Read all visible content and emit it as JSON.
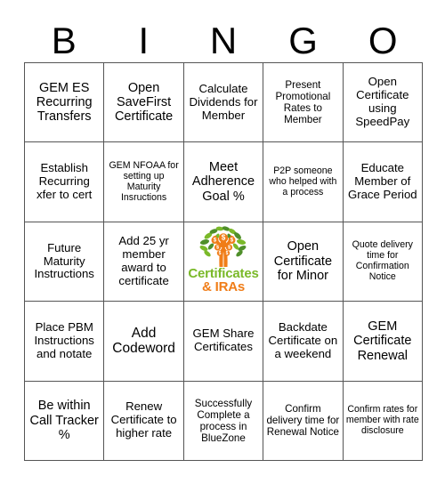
{
  "header": {
    "letters": [
      "B",
      "I",
      "N",
      "G",
      "O"
    ]
  },
  "free_space": {
    "logo_line1": "Certificates",
    "logo_line2": "& IRAs",
    "logo_icon": "money-tree-person-icon",
    "green": "#7ab929",
    "orange": "#f07d18"
  },
  "grid": {
    "rows": 5,
    "columns": 5,
    "cells": [
      {
        "text": "GEM ES Recurring Transfers",
        "size": "fs-lg"
      },
      {
        "text": "Open SaveFirst Certificate",
        "size": "fs-lg"
      },
      {
        "text": "Calculate Dividends for Member",
        "size": "fs-md"
      },
      {
        "text": "Present Promotional Rates to Member",
        "size": "fs-sm"
      },
      {
        "text": "Open Certificate using SpeedPay",
        "size": "fs-md"
      },
      {
        "text": "Establish Recurring xfer to cert",
        "size": "fs-md"
      },
      {
        "text": "GEM NFOAA for setting up Maturity Insructions",
        "size": "fs-xs"
      },
      {
        "text": "Meet Adherence Goal %",
        "size": "fs-lg"
      },
      {
        "text": "P2P someone who helped with a process",
        "size": "fs-xs"
      },
      {
        "text": "Educate Member of Grace Period",
        "size": "fs-md"
      },
      {
        "text": "Future Maturity Instructions",
        "size": "fs-md"
      },
      {
        "text": "Add 25 yr member award to certificate",
        "size": "fs-md"
      },
      {
        "text": "",
        "size": "free"
      },
      {
        "text": "Open Certificate for Minor",
        "size": "fs-lg"
      },
      {
        "text": "Quote delivery time for Confirmation Notice",
        "size": "fs-xs"
      },
      {
        "text": "Place PBM Instructions and notate",
        "size": "fs-md"
      },
      {
        "text": "Add Codeword",
        "size": "fs-xl"
      },
      {
        "text": "GEM Share Certificates",
        "size": "fs-md"
      },
      {
        "text": "Backdate Certificate on a weekend",
        "size": "fs-md"
      },
      {
        "text": "GEM Certificate Renewal",
        "size": "fs-lg"
      },
      {
        "text": "Be within Call Tracker %",
        "size": "fs-lg"
      },
      {
        "text": "Renew Certificate to higher rate",
        "size": "fs-md"
      },
      {
        "text": "Successfully Complete a process in BlueZone",
        "size": "fs-sm"
      },
      {
        "text": "Confirm delivery time for Renewal Notice",
        "size": "fs-sm"
      },
      {
        "text": "Confirm rates for member with rate disclosure",
        "size": "fs-xs"
      }
    ]
  }
}
